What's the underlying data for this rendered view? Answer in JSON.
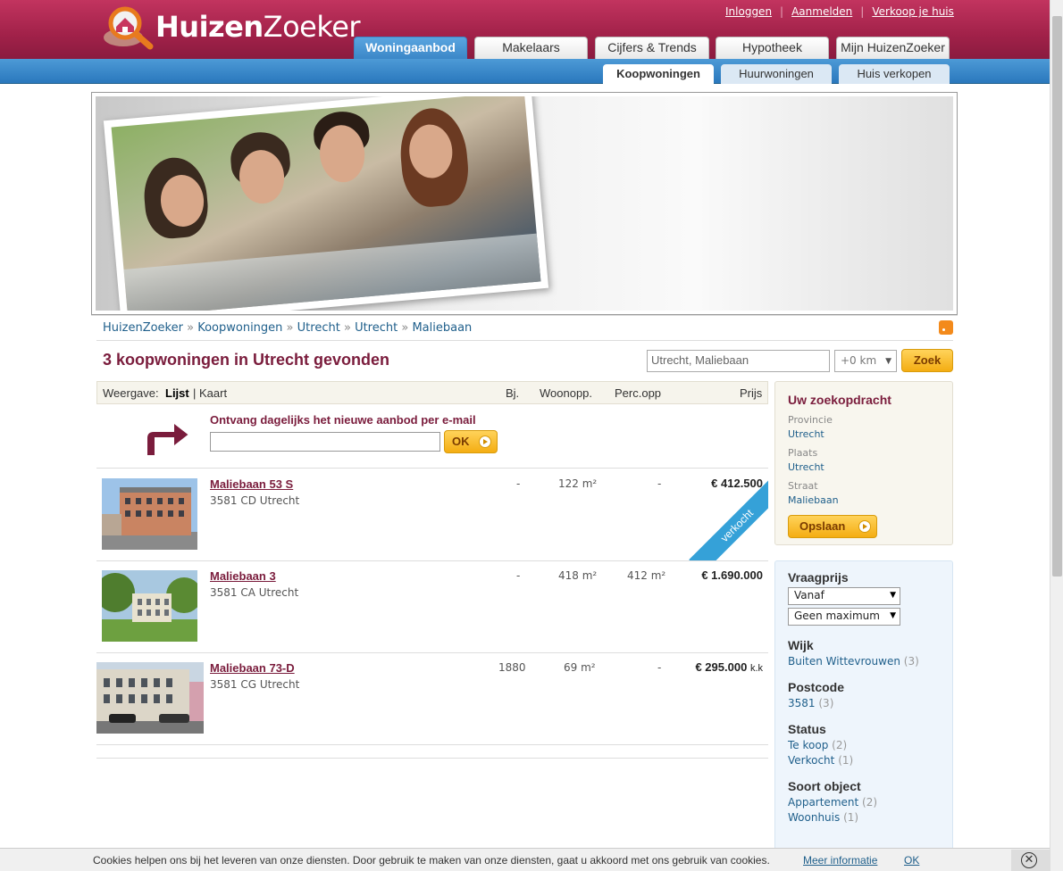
{
  "header": {
    "logo": {
      "part1": "Huizen",
      "part2": "Zoeker"
    },
    "toplinks": [
      "Inloggen",
      "Aanmelden",
      "Verkoop je huis"
    ],
    "tabs": [
      "Woningaanbod",
      "Makelaars",
      "Cijfers & Trends",
      "Hypotheek",
      "Mijn HuizenZoeker"
    ],
    "subtabs": [
      "Koopwoningen",
      "Huurwoningen",
      "Huis verkopen"
    ]
  },
  "breadcrumb": [
    "HuizenZoeker",
    "Koopwoningen",
    "Utrecht",
    "Utrecht",
    "Maliebaan"
  ],
  "breadcrumb_sep": "»",
  "result_title": "3 koopwoningen in Utrecht gevonden",
  "search": {
    "value": "Utrecht, Maliebaan",
    "km": "+0 km",
    "button": "Zoek"
  },
  "list_header": {
    "view_label": "Weergave:",
    "view_list": "Lijst",
    "view_sep": "|",
    "view_map": "Kaart",
    "cols": [
      "Bj.",
      "Woonopp.",
      "Perc.opp",
      "Prijs"
    ]
  },
  "alert": {
    "text": "Ontvang dagelijks het nieuwe aanbod per e-mail",
    "button": "OK"
  },
  "listings": [
    {
      "title": "Maliebaan 53 S",
      "address": "3581 CD Utrecht",
      "year": "-",
      "living": "122 m²",
      "plot": "-",
      "price": "€ 412.500",
      "suffix": "",
      "ribbon": "verkocht"
    },
    {
      "title": "Maliebaan 3",
      "address": "3581 CA Utrecht",
      "year": "-",
      "living": "418 m²",
      "plot": "412 m²",
      "price": "€ 1.690.000",
      "suffix": "",
      "ribbon": ""
    },
    {
      "title": "Maliebaan 73-D",
      "address": "3581 CG Utrecht",
      "year": "1880",
      "living": "69 m²",
      "plot": "-",
      "price": "€ 295.000",
      "suffix": "k.k",
      "ribbon": ""
    }
  ],
  "sidebar": {
    "search_title": "Uw zoekopdracht",
    "criteria": [
      {
        "label": "Provincie",
        "value": "Utrecht"
      },
      {
        "label": "Plaats",
        "value": "Utrecht"
      },
      {
        "label": "Straat",
        "value": "Maliebaan"
      }
    ],
    "save_button": "Opslaan",
    "price_head": "Vraagprijs",
    "price_from": "Vanaf",
    "price_to": "Geen maximum",
    "filters": [
      {
        "head": "Wijk",
        "items": [
          {
            "label": "Buiten Wittevrouwen",
            "count": "(3)"
          }
        ]
      },
      {
        "head": "Postcode",
        "items": [
          {
            "label": "3581",
            "count": "(3)"
          }
        ]
      },
      {
        "head": "Status",
        "items": [
          {
            "label": "Te koop",
            "count": "(2)"
          },
          {
            "label": "Verkocht",
            "count": "(1)"
          }
        ]
      },
      {
        "head": "Soort object",
        "items": [
          {
            "label": "Appartement",
            "count": "(2)"
          },
          {
            "label": "Woonhuis",
            "count": "(1)"
          }
        ]
      }
    ]
  },
  "cookie": {
    "text": "Cookies helpen ons bij het leveren van onze diensten. Door gebruik te maken van onze diensten, gaat u akkoord met ons gebruik van cookies.",
    "more": "Meer informatie",
    "ok": "OK"
  },
  "colors": {
    "brand": "#a12149",
    "nav_blue": "#2a78bd",
    "link": "#1f5f8b",
    "button_yellow": "#f4ad12"
  }
}
